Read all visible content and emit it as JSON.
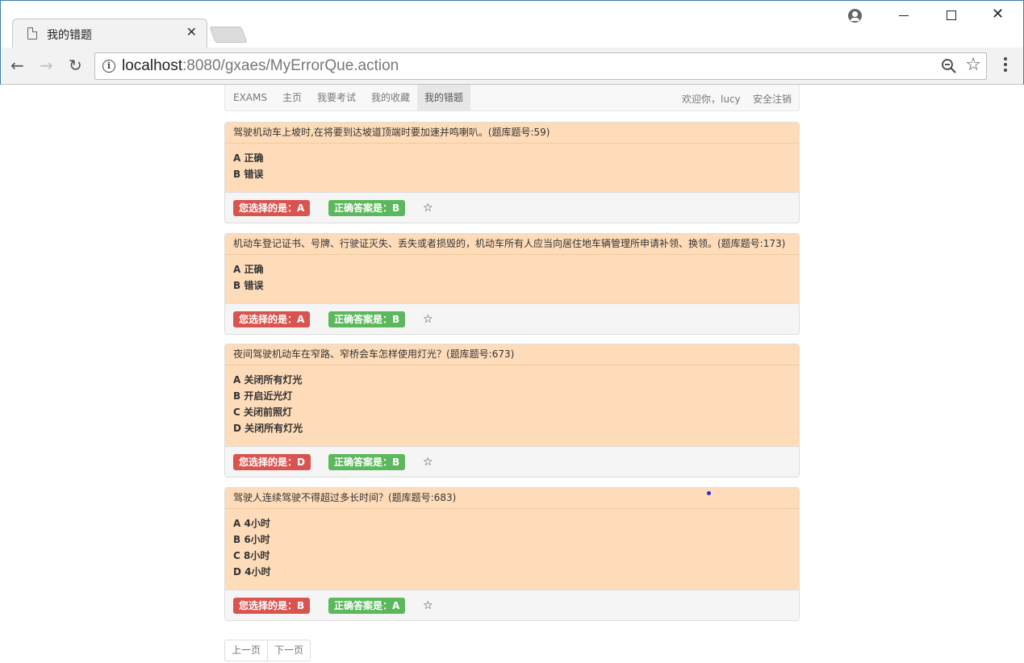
{
  "browser": {
    "tab_title": "我的错题",
    "tab_close": "✕",
    "url_host": "localhost",
    "url_rest": ":8080/gxaes/MyErrorQue.action",
    "back": "←",
    "forward": "→",
    "reload": "↻",
    "info": "i",
    "bookmark": "☆",
    "window_close": "✕"
  },
  "navbar": {
    "brand": "EXAMS",
    "items": [
      {
        "label": "主页"
      },
      {
        "label": "我要考试"
      },
      {
        "label": "我的收藏"
      },
      {
        "label": "我的错题"
      }
    ],
    "welcome": "欢迎你，lucy",
    "logout": "安全注销"
  },
  "questions": [
    {
      "title": "驾驶机动车上坡时,在将要到达坡道顶端时要加速并鸣喇叭。(题库题号:59)",
      "options": [
        "A 正确",
        "B 错误"
      ],
      "your_answer": "您选择的是：A",
      "correct_answer": "正确答案是：B",
      "star": "☆"
    },
    {
      "title": "机动车登记证书、号牌、行驶证灭失、丢失或者损毁的，机动车所有人应当向居住地车辆管理所申请补领、换领。(题库题号:173)",
      "options": [
        "A 正确",
        "B 错误"
      ],
      "your_answer": "您选择的是：A",
      "correct_answer": "正确答案是：B",
      "star": "☆"
    },
    {
      "title": "夜间驾驶机动车在窄路、窄桥会车怎样使用灯光？(题库题号:673)",
      "options": [
        "A 关闭所有灯光",
        "B 开启近光灯",
        "C 关闭前照灯",
        "D 关闭所有灯光"
      ],
      "your_answer": "您选择的是：D",
      "correct_answer": "正确答案是：B",
      "star": "☆"
    },
    {
      "title": "驾驶人连续驾驶不得超过多长时间？(题库题号:683)",
      "options": [
        "A 4小时",
        "B 6小时",
        "C 8小时",
        "D 4小时"
      ],
      "your_answer": "您选择的是：B",
      "correct_answer": "正确答案是：A",
      "star": "☆"
    }
  ],
  "pager": {
    "prev": "上一页",
    "next": "下一页"
  }
}
